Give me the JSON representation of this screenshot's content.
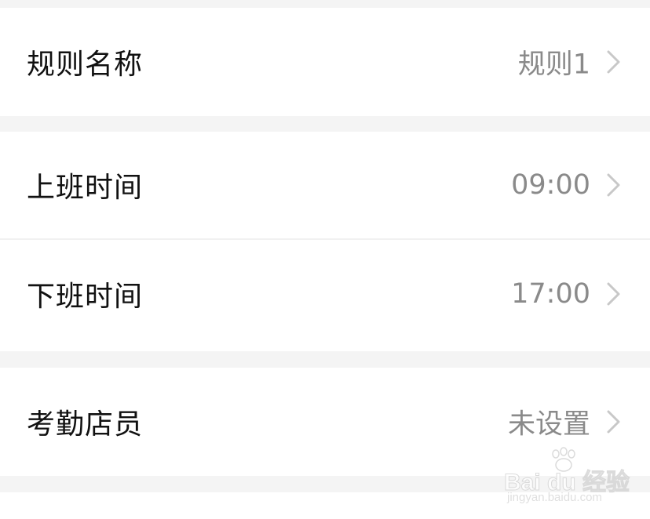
{
  "groups": [
    {
      "items": [
        {
          "label": "规则名称",
          "value": "规则1",
          "icon": "chevron-right-icon"
        }
      ]
    },
    {
      "items": [
        {
          "label": "上班时间",
          "value": "09:00",
          "icon": "chevron-right-icon"
        },
        {
          "label": "下班时间",
          "value": "17:00",
          "icon": "chevron-right-icon"
        }
      ]
    },
    {
      "items": [
        {
          "label": "考勤店员",
          "value": "未设置",
          "icon": "chevron-right-icon"
        }
      ]
    }
  ],
  "watermark": {
    "brand": "Bai du 经验",
    "url": "jingyan.baidu.com",
    "icon": "paw-logo-icon"
  },
  "colors": {
    "background": "#f4f4f4",
    "surface": "#ffffff",
    "label_text": "#111111",
    "value_text": "#8a8a8a",
    "chevron": "#c8c8c8"
  }
}
